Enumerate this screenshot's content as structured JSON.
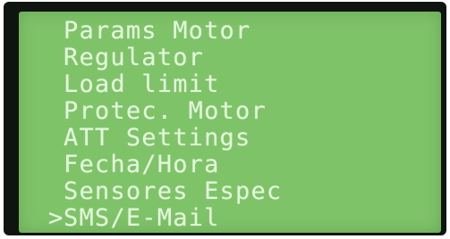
{
  "display": {
    "cursor": ">",
    "selected_index": 7,
    "colors": {
      "bezel": "#101411",
      "backlight": "#7fc369",
      "text": "#e4f7dc"
    },
    "menu_items": [
      {
        "label": "Params Motor"
      },
      {
        "label": "Regulator"
      },
      {
        "label": "Load limit"
      },
      {
        "label": "Protec. Motor"
      },
      {
        "label": "ATT Settings"
      },
      {
        "label": "Fecha/Hora"
      },
      {
        "label": "Sensores Espec"
      },
      {
        "label": "SMS/E-Mail"
      }
    ]
  }
}
